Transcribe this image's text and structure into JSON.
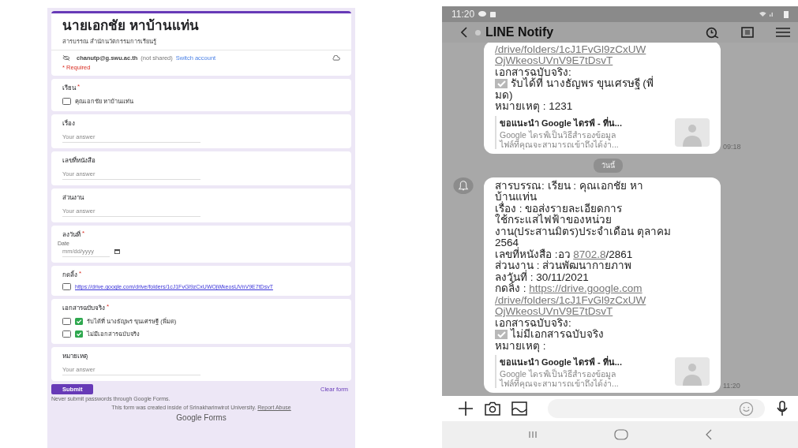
{
  "form": {
    "title": "นายเอกชัย หาบ้านแท่น",
    "description": "สารบรรณ สำนักนวัตกรรมการเรียนรู้",
    "account": {
      "email": "chanutp@g.swu.ac.th",
      "note": "(not shared)",
      "link": "Switch account"
    },
    "required_note": "* Required",
    "required_mark": "*",
    "questions": [
      {
        "kind": "checkbox",
        "label": "เรียน",
        "required": true,
        "options": [
          {
            "label": "คุณเอกชัย หาบ้านแท่น",
            "checked": false,
            "link": false,
            "prefix_check": false
          }
        ]
      },
      {
        "kind": "text",
        "label": "เรื่อง",
        "required": false,
        "placeholder": "Your answer"
      },
      {
        "kind": "text",
        "label": "เลขที่หนังสือ",
        "required": false,
        "placeholder": "Your answer"
      },
      {
        "kind": "text",
        "label": "ส่วนงาน",
        "required": false,
        "placeholder": "Your answer"
      },
      {
        "kind": "date",
        "label": "ลงวันที่",
        "required": true,
        "sublabel": "Date",
        "placeholder": "mm/dd/yyyy"
      },
      {
        "kind": "checkbox",
        "label": "กดลิ้ง",
        "required": true,
        "options": [
          {
            "label": "https://drive.google.com/drive/folders/1cJ1FvGl9zCxUWOjWkeosUVnV9E7tDsvT",
            "checked": false,
            "link": true,
            "prefix_check": false
          }
        ]
      },
      {
        "kind": "checkbox",
        "label": "เอกสารฉบับจริง",
        "required": true,
        "options": [
          {
            "label": "รับได้ที่ นางธัญพร ขุนเศรษฐี (พี่มด)",
            "checked": false,
            "link": false,
            "prefix_check": true
          },
          {
            "label": "ไม่มีเอกสารฉบับจริง",
            "checked": false,
            "link": false,
            "prefix_check": true
          }
        ]
      },
      {
        "kind": "text",
        "label": "หมายเหตุ",
        "required": false,
        "placeholder": "Your answer"
      }
    ],
    "submit": "Submit",
    "clear": "Clear form",
    "footer_note": "Never submit passwords through Google Forms.",
    "created_text": "This form was created inside of Srinakharinwirot University.",
    "report_link": "Report Abuse",
    "brand": "Google Forms"
  },
  "phone": {
    "status_bar": {
      "time": "11:20"
    },
    "header": {
      "title": "LINE Notify"
    },
    "chat": [
      {
        "kind": "message",
        "avatar": false,
        "time": "09:18",
        "lines": [
          {
            "kind": "text",
            "segments": [
              {
                "text": "/drive/folders/1cJ1FvGl9zCxUW",
                "link": true
              }
            ]
          },
          {
            "kind": "text",
            "segments": [
              {
                "text": "OjWkeosUVnV9E7tDsvT",
                "link": true
              }
            ]
          },
          {
            "kind": "text",
            "segments": [
              {
                "text": "เอกสารฉบับจริง:",
                "link": false
              }
            ]
          },
          {
            "kind": "checked",
            "segments": [
              {
                "text": "รับได้ที่ นางธัญพร ขุนเศรษฐี (พี่",
                "link": false
              }
            ]
          },
          {
            "kind": "text",
            "segments": [
              {
                "text": "มด)",
                "link": false
              }
            ]
          },
          {
            "kind": "text",
            "segments": [
              {
                "text": "หมายเหตุ : 1231",
                "link": false
              }
            ]
          }
        ],
        "preview": {
          "title": "ขอแนะนำ Google ไดรฟ์ - ที่น...",
          "lines": [
            "Google ไดรฟ์เป็นวิธีสำรองข้อมูล",
            "ไฟล์ที่คุณจะสามารถเข้าถึงได้ง่า..."
          ]
        }
      },
      {
        "kind": "divider",
        "label": "วันนี้"
      },
      {
        "kind": "message",
        "avatar": true,
        "time": "11:20",
        "lines": [
          {
            "kind": "text",
            "segments": [
              {
                "text": "สารบรรณ: เรียน : คุณเอกชัย หา",
                "link": false
              }
            ]
          },
          {
            "kind": "text",
            "segments": [
              {
                "text": "บ้านแท่น",
                "link": false
              }
            ]
          },
          {
            "kind": "text",
            "segments": [
              {
                "text": "เรื่อง : ขอส่งรายละเอียดการ",
                "link": false
              }
            ]
          },
          {
            "kind": "text",
            "segments": [
              {
                "text": "ใช้กระแสไฟฟ้าของหน่วย",
                "link": false
              }
            ]
          },
          {
            "kind": "text",
            "segments": [
              {
                "text": "งาน(ประสานมิตร)ประจำเดือน ตุลาคม",
                "link": false
              }
            ]
          },
          {
            "kind": "text",
            "segments": [
              {
                "text": "2564",
                "link": false
              }
            ]
          },
          {
            "kind": "text",
            "segments": [
              {
                "text": "เลขที่หนังสือ :อว ",
                "link": false
              },
              {
                "text": "8702.8",
                "link": true
              },
              {
                "text": "/2861",
                "link": false
              }
            ]
          },
          {
            "kind": "text",
            "segments": [
              {
                "text": "ส่วนงาน : ส่วนพัฒนากายภาพ",
                "link": false
              }
            ]
          },
          {
            "kind": "text",
            "segments": [
              {
                "text": "ลงวันที่ : 30/11/2021",
                "link": false
              }
            ]
          },
          {
            "kind": "text",
            "segments": [
              {
                "text": "กดลิ้ง : ",
                "link": false
              },
              {
                "text": "https://drive.google.com",
                "link": true
              }
            ]
          },
          {
            "kind": "text",
            "segments": [
              {
                "text": "/drive/folders/1cJ1FvGl9zCxUW",
                "link": true
              }
            ]
          },
          {
            "kind": "text",
            "segments": [
              {
                "text": "OjWkeosUVnV9E7tDsvT",
                "link": true
              }
            ]
          },
          {
            "kind": "text",
            "segments": [
              {
                "text": "เอกสารฉบับจริง:",
                "link": false
              }
            ]
          },
          {
            "kind": "checked",
            "segments": [
              {
                "text": "ไม่มีเอกสารฉบับจริง",
                "link": false
              }
            ]
          },
          {
            "kind": "text",
            "segments": [
              {
                "text": "หมายเหตุ :",
                "link": false
              }
            ]
          }
        ],
        "preview": {
          "title": "ขอแนะนำ Google ไดรฟ์ - ที่น...",
          "lines": [
            "Google ไดรฟ์เป็นวิธีสำรองข้อมูล",
            "ไฟล์ที่คุณจะสามารถเข้าถึงได้ง่า..."
          ]
        }
      }
    ]
  }
}
